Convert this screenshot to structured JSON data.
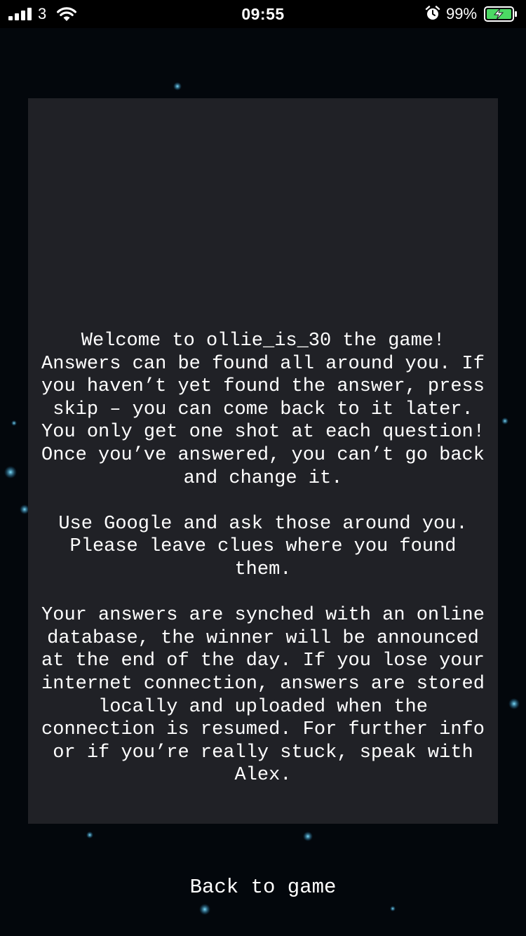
{
  "status_bar": {
    "carrier": "3",
    "time": "09:55",
    "battery_percent": "99%",
    "icons": [
      "cellular-signal-icon",
      "wifi-icon",
      "alarm-icon",
      "battery-charging-icon"
    ]
  },
  "intro": {
    "paragraphs": [
      "Welcome to ollie_is_30 the game! Answers can be found all around you. If you haven’t yet found the answer, press skip – you can come back to it later. You only get one shot at each question! Once you’ve answered, you can’t go back and change it.",
      "Use Google and ask those around you. Please leave clues where you found them.",
      "Your answers are synched with an online database, the winner will be announced at the end of the day. If you lose your internet connection, answers are stored locally and uploaded when the connection is resumed. For further info or if you’re really stuck, speak with Alex."
    ]
  },
  "footer": {
    "back_label": "Back to game"
  },
  "colors": {
    "background": "#04060a",
    "panel": "#202126",
    "text": "#ffffff",
    "battery_green": "#4cd964",
    "accent_glow": "#3ec6ff"
  }
}
